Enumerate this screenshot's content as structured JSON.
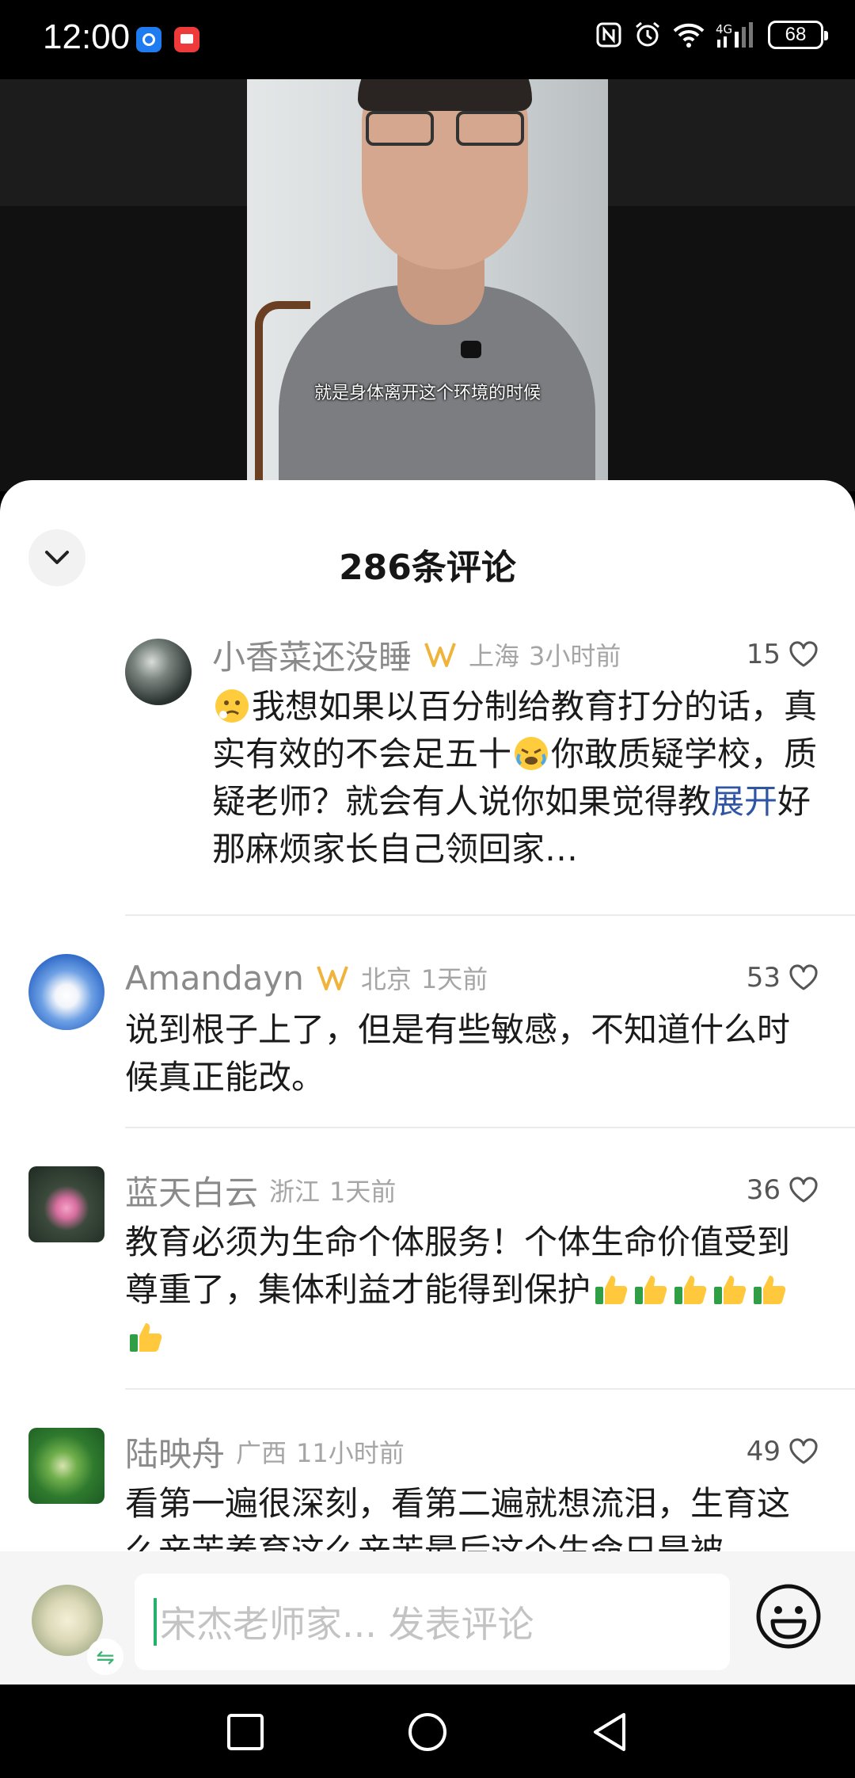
{
  "status_bar": {
    "time": "12:00",
    "battery": "68",
    "icons": [
      "nfc-icon",
      "alarm-icon",
      "wifi-icon",
      "4g-signal-icon",
      "battery-icon"
    ]
  },
  "video": {
    "subtitle": "就是身体离开这个环境的时候"
  },
  "comments_sheet": {
    "title": "286条评论",
    "collapse_icon": "chevron-down-icon"
  },
  "comments": [
    {
      "name": "小香菜还没睡",
      "badge": "vip-badge-icon",
      "location": "上海",
      "time": "3小时前",
      "likes": "15",
      "text": "我想如果以百分制给教育打分的话，真实有效的不会足五十",
      "text2": "你敢质疑学校，质疑老师？就会有人说你如果觉得教",
      "text_overlay": "展开",
      "text3": "好那麻烦家长自己领回家…"
    },
    {
      "name": "Amandayn",
      "badge": "vip-badge-icon",
      "location": "北京",
      "time": "1天前",
      "likes": "53",
      "text": "说到根子上了，但是有些敏感，不知道什么时候真正能改。"
    },
    {
      "name": "蓝天白云",
      "location": "浙江",
      "time": "1天前",
      "likes": "36",
      "text": "教育必须为生命个体服务！个体生命价值受到尊重了，集体利益才能得到保护"
    },
    {
      "name": "陆映舟",
      "location": "广西",
      "time": "11小时前",
      "likes": "49",
      "text": "看第一遍很深刻，看第二遍就想流泪，生育这么辛苦养育这么辛苦最后这个生命只是被"
    }
  ],
  "input_bar": {
    "placeholder": "宋杰老师家... 发表评论",
    "swap_icon": "⇋"
  },
  "colors": {
    "accent": "#21b36b",
    "badge_gold": "#f0b43c"
  }
}
